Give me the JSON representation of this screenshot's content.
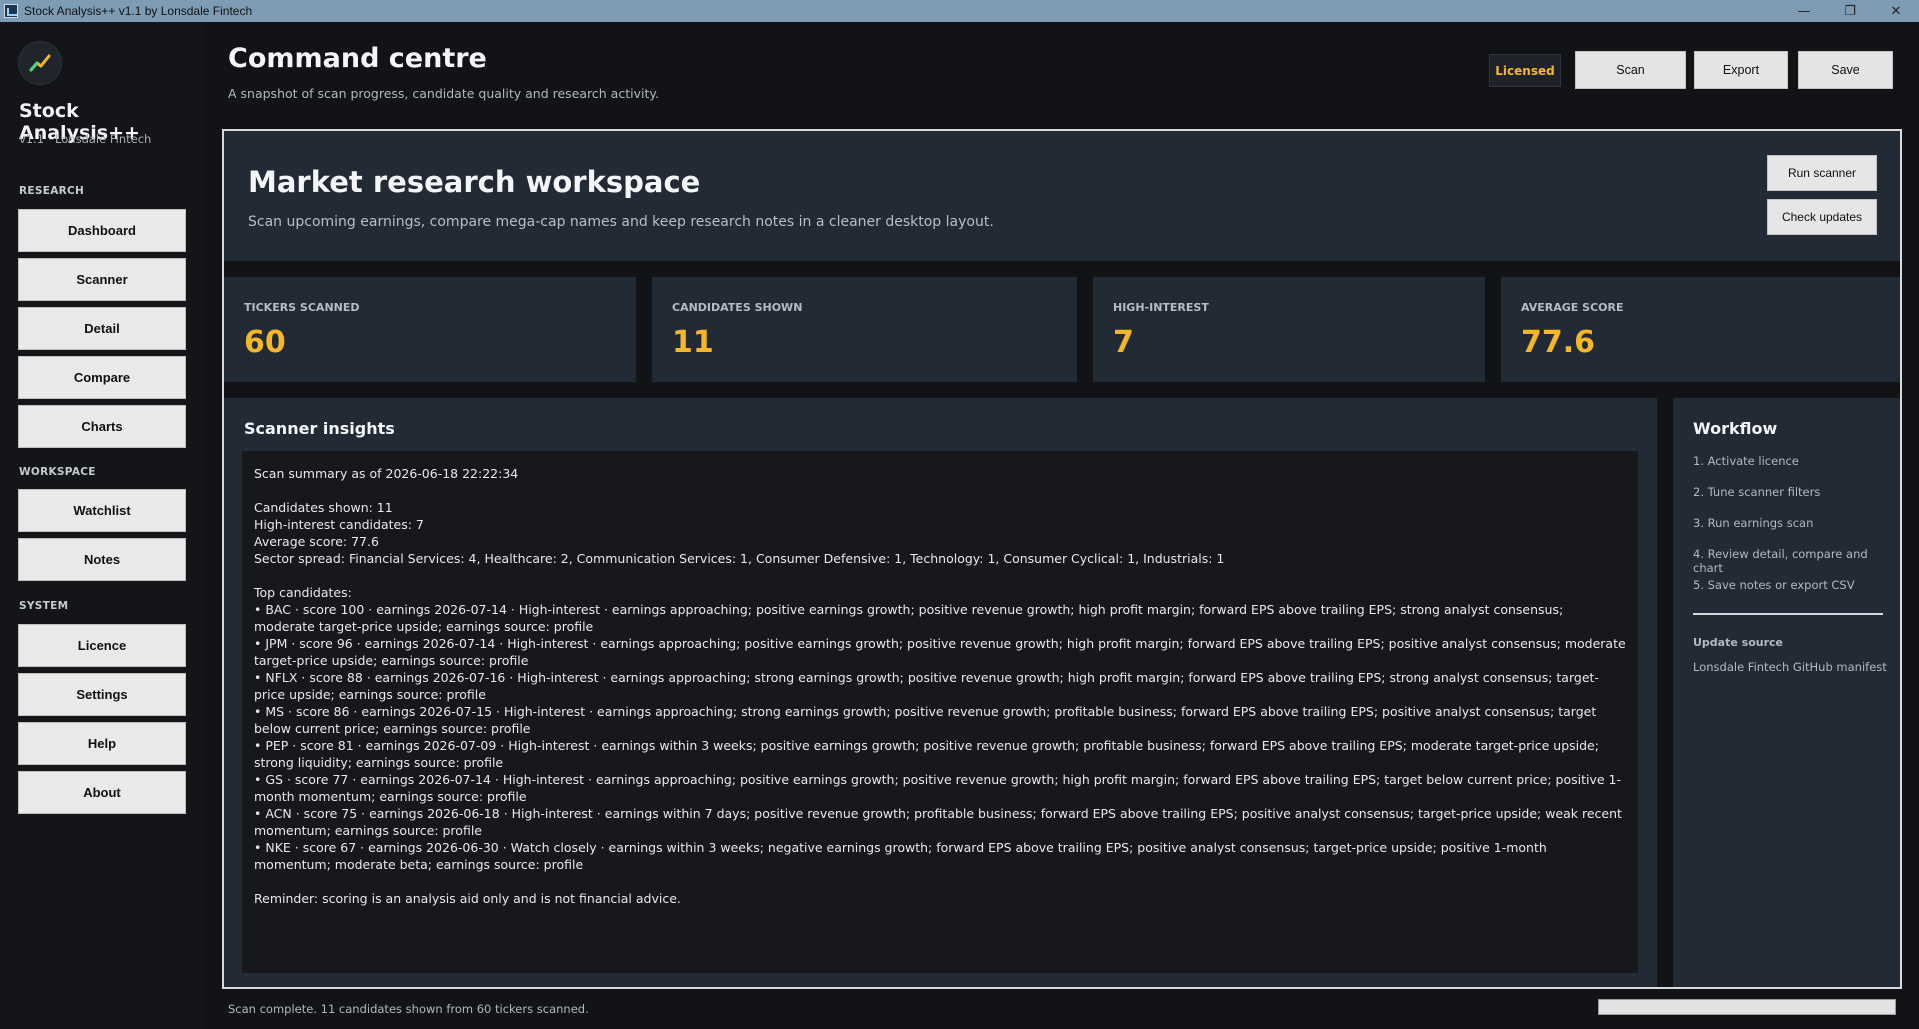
{
  "window": {
    "title": "Stock Analysis++ v1.1 by Lonsdale Fintech",
    "controls": [
      "—",
      "❐",
      "✕"
    ]
  },
  "sidebar": {
    "app_name": "Stock Analysis++",
    "version": "v1.1 · Lonsdale Fintech",
    "sections": {
      "research": "RESEARCH",
      "workspace": "WORKSPACE",
      "system": "SYSTEM"
    },
    "research_items": [
      "Dashboard",
      "Scanner",
      "Detail",
      "Compare",
      "Charts"
    ],
    "workspace_items": [
      "Watchlist",
      "Notes"
    ],
    "system_items": [
      "Licence",
      "Settings",
      "Help",
      "About"
    ]
  },
  "header": {
    "title": "Command centre",
    "subtitle": "A snapshot of scan progress, candidate quality and research activity.",
    "badge": "Licensed",
    "buttons": {
      "scan": "Scan",
      "export": "Export",
      "save": "Save"
    }
  },
  "hero": {
    "title": "Market research workspace",
    "subtitle": "Scan upcoming earnings, compare mega-cap names and keep research notes in a cleaner desktop layout.",
    "run_scanner": "Run scanner",
    "check_updates": "Check updates"
  },
  "stats": [
    {
      "label": "TICKERS SCANNED",
      "value": "60"
    },
    {
      "label": "CANDIDATES SHOWN",
      "value": "11"
    },
    {
      "label": "HIGH-INTEREST",
      "value": "7"
    },
    {
      "label": "AVERAGE SCORE",
      "value": "77.6"
    }
  ],
  "insights": {
    "title": "Scanner insights",
    "text": "Scan summary as of 2026-06-18 22:22:34\n\nCandidates shown: 11\nHigh-interest candidates: 7\nAverage score: 77.6\nSector spread: Financial Services: 4, Healthcare: 2, Communication Services: 1, Consumer Defensive: 1, Technology: 1, Consumer Cyclical: 1, Industrials: 1\n\nTop candidates:\n• BAC · score 100 · earnings 2026-07-14 · High-interest · earnings approaching; positive earnings growth; positive revenue growth; high profit margin; forward EPS above trailing EPS; strong analyst consensus; moderate target-price upside; earnings source: profile\n• JPM · score 96 · earnings 2026-07-14 · High-interest · earnings approaching; positive earnings growth; positive revenue growth; high profit margin; forward EPS above trailing EPS; positive analyst consensus; moderate target-price upside; earnings source: profile\n• NFLX · score 88 · earnings 2026-07-16 · High-interest · earnings approaching; strong earnings growth; positive revenue growth; high profit margin; forward EPS above trailing EPS; strong analyst consensus; target-price upside; earnings source: profile\n• MS · score 86 · earnings 2026-07-15 · High-interest · earnings approaching; strong earnings growth; positive revenue growth; profitable business; forward EPS above trailing EPS; positive analyst consensus; target below current price; earnings source: profile\n• PEP · score 81 · earnings 2026-07-09 · High-interest · earnings within 3 weeks; positive earnings growth; positive revenue growth; profitable business; forward EPS above trailing EPS; moderate target-price upside; strong liquidity; earnings source: profile\n• GS · score 77 · earnings 2026-07-14 · High-interest · earnings approaching; positive earnings growth; positive revenue growth; high profit margin; forward EPS above trailing EPS; target below current price; positive 1-month momentum; earnings source: profile\n• ACN · score 75 · earnings 2026-06-18 · High-interest · earnings within 7 days; positive revenue growth; profitable business; forward EPS above trailing EPS; positive analyst consensus; target-price upside; weak recent momentum; earnings source: profile\n• NKE · score 67 · earnings 2026-06-30 · Watch closely · earnings within 3 weeks; negative earnings growth; forward EPS above trailing EPS; positive analyst consensus; target-price upside; positive 1-month momentum; moderate beta; earnings source: profile\n\nReminder: scoring is an analysis aid only and is not financial advice."
  },
  "workflow": {
    "title": "Workflow",
    "steps": [
      "1. Activate licence",
      "2. Tune scanner filters",
      "3. Run earnings scan",
      "4. Review detail, compare and chart",
      "5. Save notes or export CSV"
    ],
    "update_source_label": "Update source",
    "update_source_value": "Lonsdale Fintech GitHub manifest"
  },
  "status": {
    "text": "Scan complete. 11 candidates shown from 60 tickers scanned.",
    "progress": 1.0
  },
  "colors": {
    "accent": "#f5b72a",
    "panel": "#222a36",
    "background": "#111317",
    "titlebar": "#7d9cb3"
  },
  "icons": {
    "logo": "trend-line-icon",
    "app": "chart-app-icon"
  }
}
